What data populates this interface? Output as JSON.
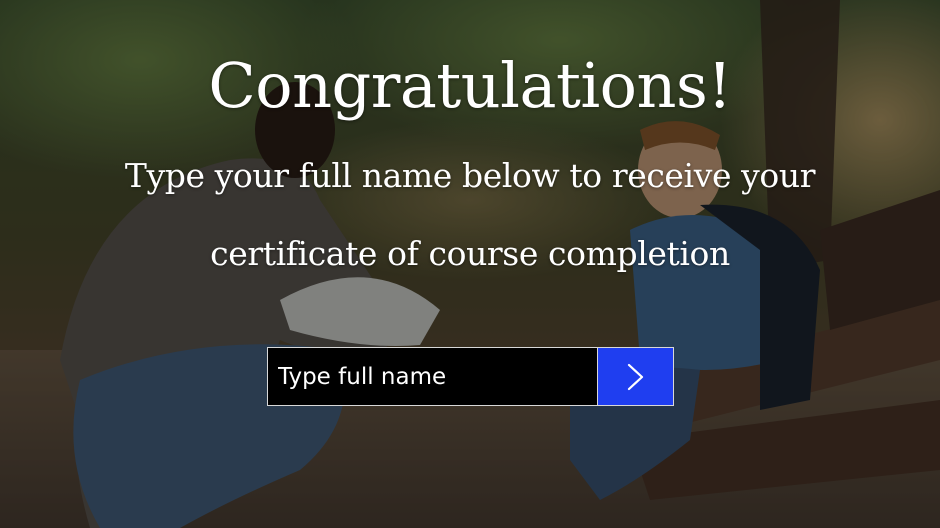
{
  "heading": "Congratulations!",
  "instructions": {
    "line1": "Type your full name below to receive your",
    "line2": "certificate of course completion"
  },
  "name_form": {
    "placeholder": "Type full name",
    "submit_icon": "chevron-right-icon",
    "button_color": "#1f3ef0"
  },
  "background_photo": "man-and-boy-in-park"
}
